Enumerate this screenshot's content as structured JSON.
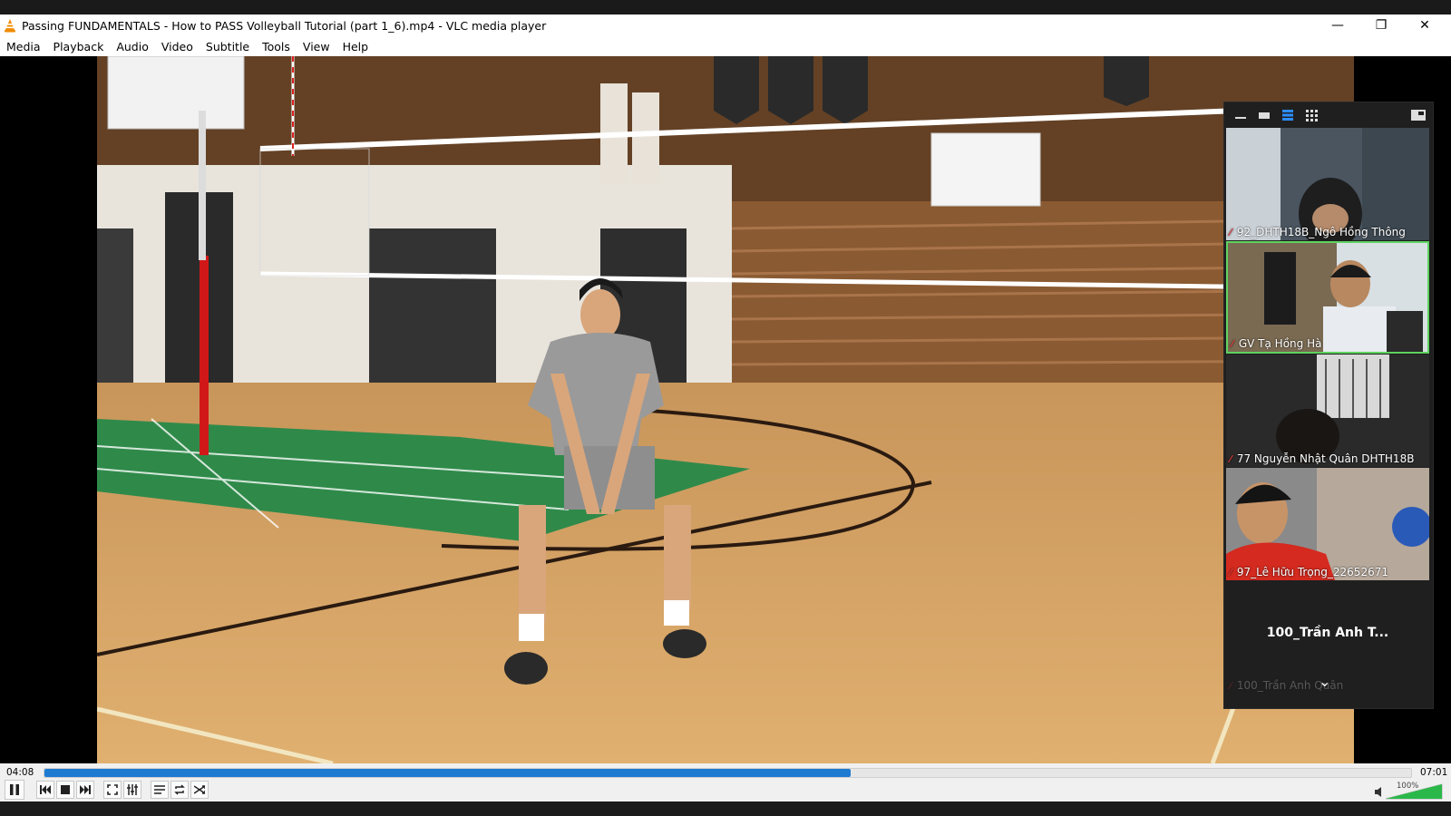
{
  "window": {
    "title": "Passing FUNDAMENTALS - How to PASS Volleyball Tutorial (part 1_6).mp4 - VLC media player",
    "minimize_glyph": "—",
    "maximize_glyph": "❐",
    "close_glyph": "✕"
  },
  "menu": {
    "items": [
      {
        "label": "Media"
      },
      {
        "label": "Playback"
      },
      {
        "label": "Audio"
      },
      {
        "label": "Video"
      },
      {
        "label": "Subtitle"
      },
      {
        "label": "Tools"
      },
      {
        "label": "View"
      },
      {
        "label": "Help"
      }
    ]
  },
  "zoom": {
    "toolbar_icons": [
      "minimize-icon",
      "single-view-icon",
      "strip-view-icon",
      "grid-view-icon",
      "exit-minimize-icon"
    ],
    "participants": [
      {
        "name": "92_DHTH18B_Ngô Hồng Thông",
        "muted": true
      },
      {
        "name": "GV Tạ Hồng Hà",
        "muted": true,
        "active_speaker": true
      },
      {
        "name": "77 Nguyễn Nhật Quân DHTH18B",
        "muted": true
      },
      {
        "name": "97_Lê Hữu Trọng_22652671",
        "muted": true
      }
    ],
    "no_video_participant": {
      "display_name": "100_Trần Anh T...",
      "label": "100_Trần Anh Quân"
    },
    "scroll_down_glyph": "⌄"
  },
  "player": {
    "elapsed": "04:08",
    "total": "07:01",
    "progress_fraction": 0.59,
    "volume_label": "100%",
    "volume_fraction": 1.0,
    "accent_color": "#1f7ad2",
    "volume_color": "#2bb84a"
  }
}
